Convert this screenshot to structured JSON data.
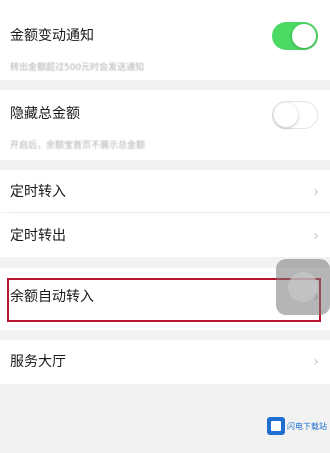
{
  "settings": {
    "balance_notice": {
      "label": "金额变动通知",
      "hint": "转出金额超过500元时会发送通知",
      "toggle_on": true
    },
    "hide_total": {
      "label": "隐藏总金额",
      "hint": "开启后，余额宝首页不展示总金额",
      "toggle_on": false
    },
    "scheduled_in": {
      "label": "定时转入",
      "chevron": "›"
    },
    "scheduled_out": {
      "label": "定时转出",
      "chevron": "›"
    },
    "auto_transfer_in": {
      "label": "余额自动转入",
      "chevron": "›"
    },
    "service_hall": {
      "label": "服务大厅",
      "chevron": "›"
    }
  },
  "watermark": {
    "text": "闪电下载站"
  },
  "colors": {
    "toggle_on": "#4cd964",
    "highlight": "#b8182e",
    "watermark": "#1e6fd0"
  }
}
